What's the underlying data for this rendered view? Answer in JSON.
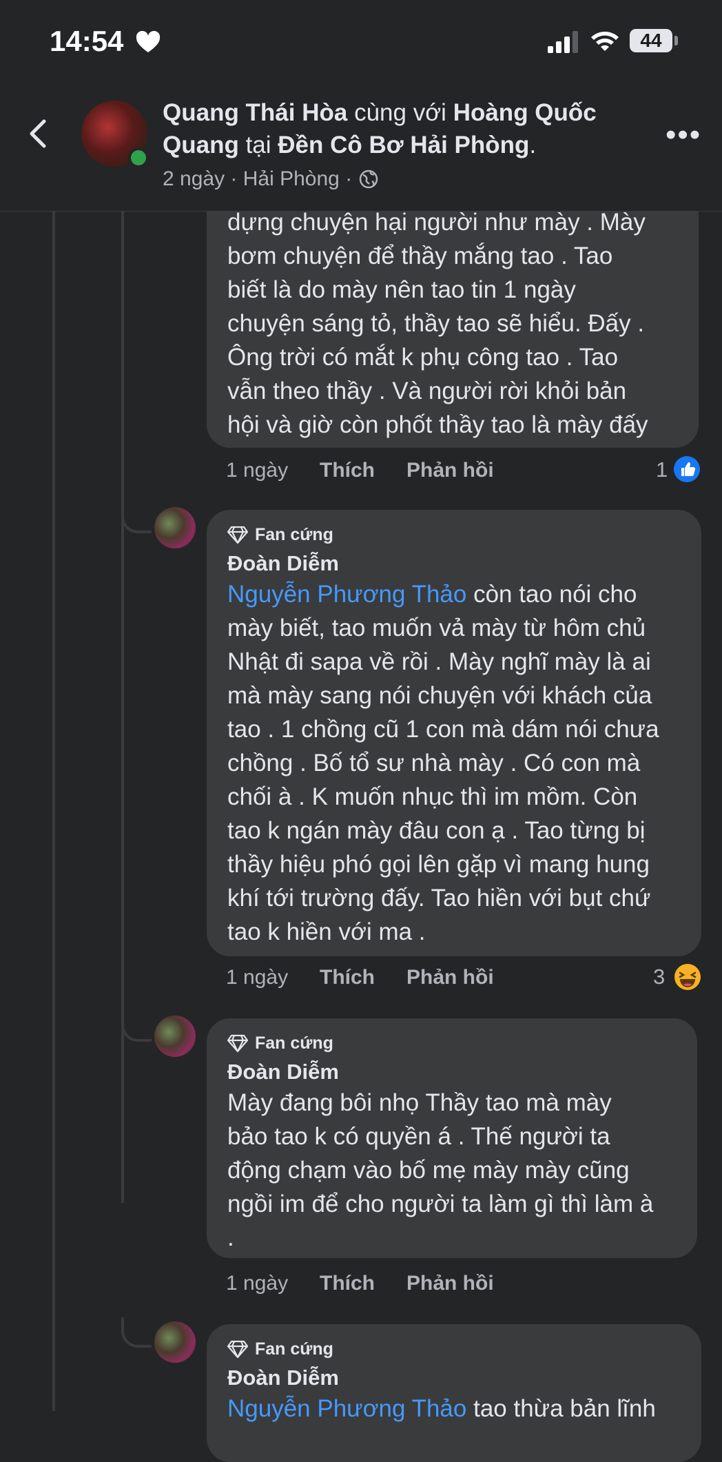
{
  "status_bar": {
    "time": "14:54",
    "battery": "44"
  },
  "post_header": {
    "author": "Quang Thái Hòa",
    "with_word": "cùng với",
    "tagged": "Hoàng Quốc Quang",
    "at_word": "tại",
    "location": "Đền Cô Bơ Hải Phòng",
    "period": ".",
    "time": "2 ngày",
    "sep1": "·",
    "place": "Hải Phòng",
    "sep2": "·"
  },
  "comments": [
    {
      "lines": [
        "dựng chuyện hại người như mày . Mày",
        "bơm chuyện để thầy mắng tao . Tao",
        "biết là do mày nên tao tin 1 ngày",
        "chuyện sáng tỏ, thầy tao sẽ hiểu. Đấy .",
        "Ông trời có mắt k phụ công tao . Tao",
        "vẫn theo thầy . Và người rời khỏi bản",
        "hội và giờ còn phốt thầy tao là mày đấy"
      ],
      "time": "1 ngày",
      "like_label": "Thích",
      "reply_label": "Phản hồi",
      "reaction_count": "1",
      "reaction": "like-icon"
    },
    {
      "badge": "Fan cứng",
      "author": "Đoàn Diễm",
      "mention": "Nguyễn Phương Thảo",
      "lines": [
        "còn tao nói cho",
        "mày biết, tao muốn vả mày từ hôm chủ",
        "Nhật đi  sapa về rồi . Mày nghĩ mày là ai",
        "mà mày sang nói chuyện với khách của",
        "tao . 1 chồng cũ 1 con mà dám nói chưa",
        "chồng . Bố tổ sư nhà mày . Có con mà",
        "chối à . K muốn nhục thì im mồm. Còn",
        "tao k ngán mày đâu con ạ . Tao từng bị",
        "thầy hiệu phó gọi lên gặp vì mang hung",
        "khí tới trường đấy. Tao hiền với bụt chứ",
        "tao k hiền với ma ."
      ],
      "time": "1 ngày",
      "like_label": "Thích",
      "reply_label": "Phản hồi",
      "reaction_count": "3",
      "reaction": "haha-icon"
    },
    {
      "badge": "Fan cứng",
      "author": "Đoàn Diễm",
      "lines": [
        "Mày đang bôi nhọ Thầy tao mà mày",
        "bảo tao k có quyền á . Thế người ta",
        "động chạm vào bố mẹ mày mày cũng",
        "ngồi im để cho người ta làm gì thì làm à",
        "."
      ],
      "time": "1 ngày",
      "like_label": "Thích",
      "reply_label": "Phản hồi"
    },
    {
      "badge": "Fan cứng",
      "author": "Đoàn Diễm",
      "mention": "Nguyễn Phương Thảo",
      "first_line_rest": "tao thừa bản lĩnh"
    }
  ],
  "colors": {
    "background": "#242526",
    "bubble": "#3a3b3c",
    "mention": "#4599ff",
    "like": "#1877f2",
    "online": "#31a24c"
  }
}
